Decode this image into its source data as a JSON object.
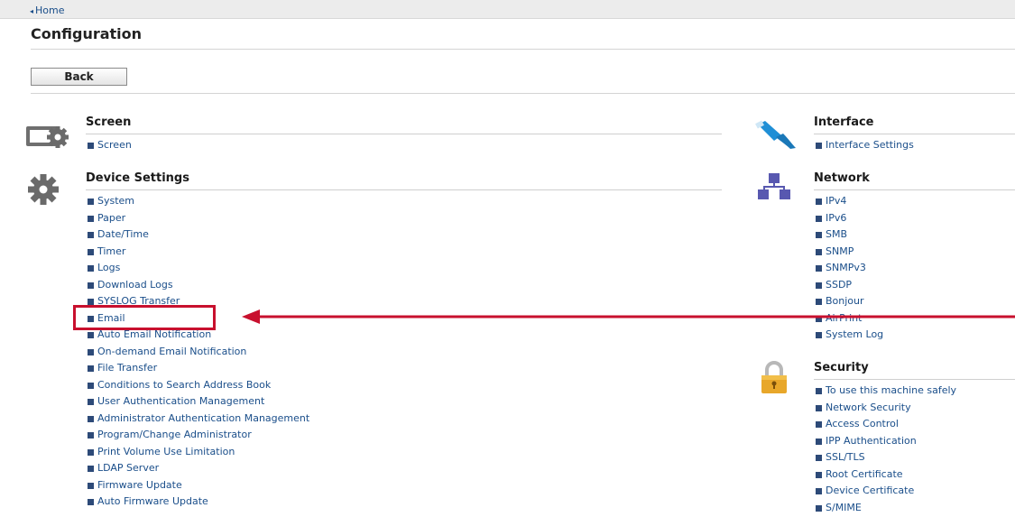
{
  "topbar": {
    "home_label": "Home",
    "home_arrow": "◂"
  },
  "page_title": "Configuration",
  "back_button": "Back",
  "colors": {
    "highlight": "#c8102e",
    "link": "#1a4e8a"
  },
  "left_sections": [
    {
      "title": "Screen",
      "icon": "screen-settings-icon",
      "items": [
        "Screen"
      ]
    },
    {
      "title": "Device Settings",
      "icon": "gear-icon",
      "items": [
        "System",
        "Paper",
        "Date/Time",
        "Timer",
        "Logs",
        "Download Logs",
        "SYSLOG Transfer",
        "Email",
        "Auto Email Notification",
        "On-demand Email Notification",
        "File Transfer",
        "Conditions to Search Address Book",
        "User Authentication Management",
        "Administrator Authentication Management",
        "Program/Change Administrator",
        "Print Volume Use Limitation",
        "LDAP Server",
        "Firmware Update",
        "Auto Firmware Update"
      ]
    }
  ],
  "right_sections": [
    {
      "title": "Interface",
      "icon": "cable-icon",
      "items": [
        "Interface Settings"
      ]
    },
    {
      "title": "Network",
      "icon": "network-icon",
      "items": [
        "IPv4",
        "IPv6",
        "SMB",
        "SNMP",
        "SNMPv3",
        "SSDP",
        "Bonjour",
        "AirPrint",
        "System Log"
      ]
    },
    {
      "title": "Security",
      "icon": "padlock-icon",
      "items": [
        "To use this machine safely",
        "Network Security",
        "Access Control",
        "IPP Authentication",
        "SSL/TLS",
        "Root Certificate",
        "Device Certificate",
        "S/MIME"
      ]
    }
  ],
  "annotation": {
    "highlighted_item": "Email",
    "arrow_direction": "left"
  }
}
